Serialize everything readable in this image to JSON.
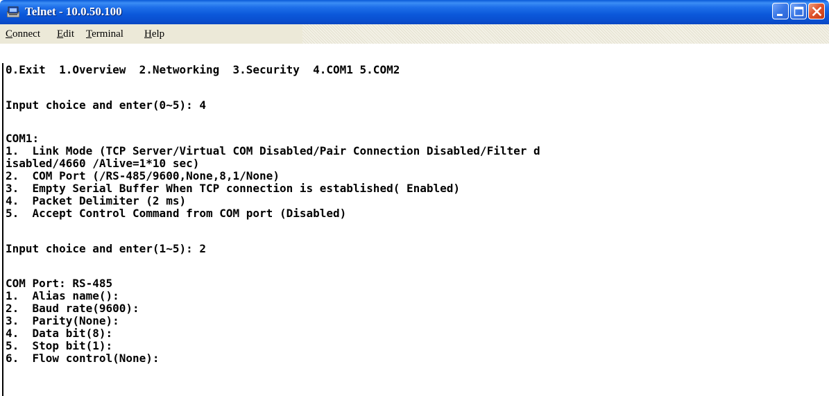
{
  "window": {
    "title": "Telnet - 10.0.50.100"
  },
  "menubar": {
    "items": [
      {
        "first": "C",
        "rest": "onnect"
      },
      {
        "first": "E",
        "rest": "dit"
      },
      {
        "first": "T",
        "rest": "erminal"
      },
      {
        "first": "H",
        "rest": "elp"
      }
    ]
  },
  "terminal": {
    "lines": [
      "0.Exit  1.Overview  2.Networking  3.Security  4.COM1 5.COM2",
      "Input choice and enter(0~5): 4",
      "COM1:",
      "1.  Link Mode (TCP Server/Virtual COM Disabled/Pair Connection Disabled/Filter d",
      "isabled/4660 /Alive=1*10 sec)",
      "2.  COM Port (/RS-485/9600,None,8,1/None)",
      "3.  Empty Serial Buffer When TCP connection is established( Enabled)",
      "4.  Packet Delimiter (2 ms)",
      "5.  Accept Control Command from COM port (Disabled)",
      "Input choice and enter(1~5): 2",
      "COM Port: RS-485",
      "1.  Alias name():",
      "2.  Baud rate(9600):",
      "3.  Parity(None):",
      "4.  Data bit(8):",
      "5.  Stop bit(1):",
      "6.  Flow control(None):"
    ]
  },
  "icons": {
    "app": "telnet-terminal-icon",
    "minimize": "minimize-icon",
    "maximize": "maximize-icon",
    "close": "close-icon"
  },
  "colors": {
    "titlebar": "#0a5ad8",
    "menubar": "#ece9d8",
    "terminal_bg": "#ffffff",
    "terminal_text": "#000000",
    "close_button": "#e0552e"
  }
}
